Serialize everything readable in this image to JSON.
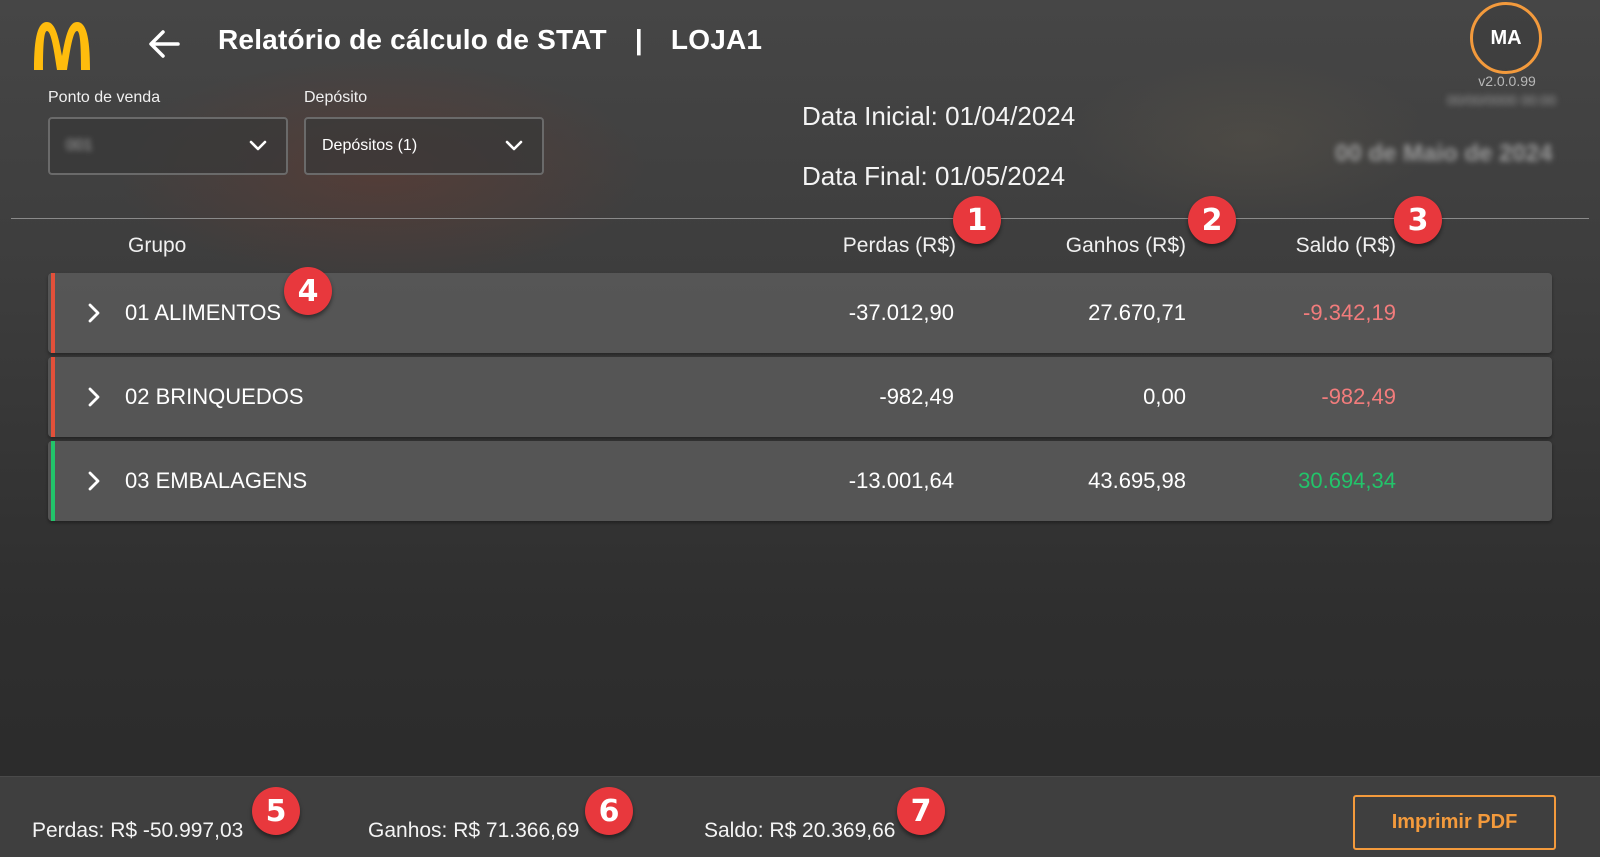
{
  "header": {
    "title": "Relatório de cálculo de STAT",
    "separator": "|",
    "store": "LOJA1",
    "avatar_initials": "MA",
    "version": "v2.0.0.99"
  },
  "filters": {
    "point_of_sale": {
      "label": "Ponto de venda",
      "value": "001"
    },
    "deposit": {
      "label": "Depósito",
      "value": "Depósitos (1)"
    }
  },
  "dates": {
    "initial_label": "Data Inicial:",
    "initial_value": "01/04/2024",
    "final_label": "Data Final:",
    "final_value": "01/05/2024"
  },
  "table": {
    "headers": {
      "group": "Grupo",
      "losses": "Perdas (R$)",
      "gains": "Ganhos (R$)",
      "balance": "Saldo (R$)"
    },
    "rows": [
      {
        "name": "01 ALIMENTOS",
        "losses": "-37.012,90",
        "gains": "27.670,71",
        "balance": "-9.342,19",
        "status": "negative"
      },
      {
        "name": "02 BRINQUEDOS",
        "losses": "-982,49",
        "gains": "0,00",
        "balance": "-982,49",
        "status": "negative"
      },
      {
        "name": "03 EMBALAGENS",
        "losses": "-13.001,64",
        "gains": "43.695,98",
        "balance": "30.694,34",
        "status": "positive"
      }
    ]
  },
  "badges": [
    "1",
    "2",
    "3",
    "4",
    "5",
    "6",
    "7"
  ],
  "footer": {
    "losses": "Perdas: R$ -50.997,03",
    "gains": "Ganhos: R$ 71.366,69",
    "balance": "Saldo: R$ 20.369,66",
    "print_label": "Imprimir PDF"
  },
  "colors": {
    "accent": "#f39a3c",
    "brand_yellow": "#ffbc0d",
    "negative": "#f27c7c",
    "positive": "#22c46a",
    "negative_bar": "#e2503a",
    "positive_bar": "#22c46a",
    "badge": "#e8383d"
  },
  "icons": {
    "logo": "mcdonalds-arches-logo",
    "back": "arrow-left-icon",
    "dropdown": "chevron-down-icon",
    "expand": "chevron-right-icon"
  }
}
